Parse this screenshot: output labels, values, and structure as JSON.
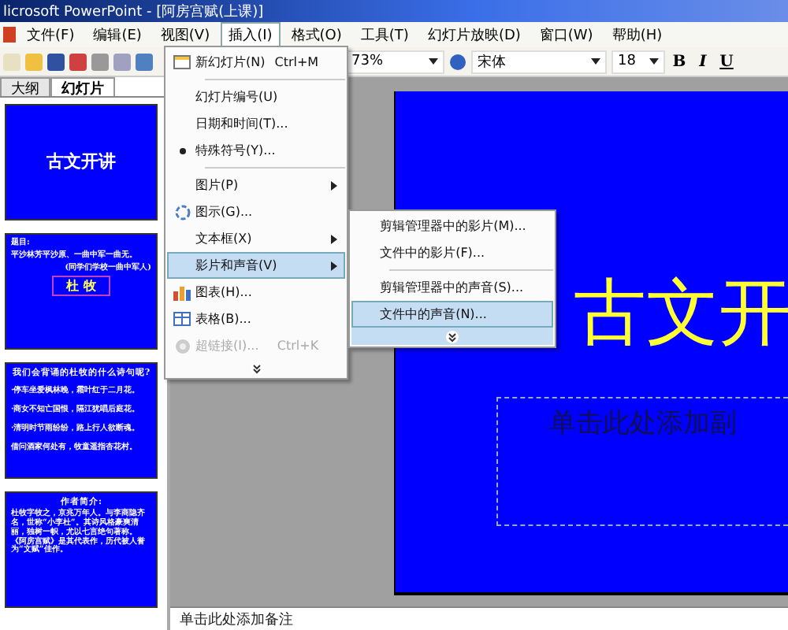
{
  "window": {
    "title": "licrosoft PowerPoint - [阿房宫赋(上课)]"
  },
  "menu_bar": [
    {
      "label": "文件(F)",
      "selected": false
    },
    {
      "label": "编辑(E)",
      "selected": false
    },
    {
      "label": "视图(V)",
      "selected": false
    },
    {
      "label": "插入(I)",
      "selected": true
    },
    {
      "label": "格式(O)",
      "selected": false
    },
    {
      "label": "工具(T)",
      "selected": false
    },
    {
      "label": "幻灯片放映(D)",
      "selected": false
    },
    {
      "label": "窗口(W)",
      "selected": false
    },
    {
      "label": "帮助(H)",
      "selected": false
    }
  ],
  "toolbar": {
    "zoom": "73%",
    "font": "宋体",
    "font_size": "18",
    "format_buttons": [
      "B",
      "I",
      "U"
    ]
  },
  "pane_tabs": [
    {
      "label": "大纲",
      "selected": false
    },
    {
      "label": "幻灯片",
      "selected": true
    }
  ],
  "thumbnails": [
    {
      "kind": "title",
      "lines": [
        "古文开讲"
      ]
    },
    {
      "kind": "intro",
      "lines": [
        "题目:",
        "平沙林芳平沙原、一曲中军一曲无。",
        "(同学们学校一曲中军人)",
        "杜  牧"
      ]
    },
    {
      "kind": "list",
      "lines": [
        "我们会背诵的杜牧的什么诗句呢?",
        "·停车坐爱枫林晚，霜叶红于二月花。",
        "·商女不知亡国恨，隔江犹唱后庭花。",
        "·清明时节雨纷纷，路上行人欲断魂。",
        "借问酒家何处有，牧童遥指杏花村。"
      ]
    },
    {
      "kind": "text",
      "lines": [
        "作者简介:",
        "杜牧字牧之，京兆万年人。与李商隐齐名，世称“小李杜”。其诗风格豪爽清丽，独树一帜，尤以七言绝句著称。《阿房宫赋》是其代表作，历代被人誉为“文赋”佳作。"
      ]
    }
  ],
  "insert_menu": [
    {
      "kind": "item",
      "label": "新幻灯片(N)",
      "shortcut": "Ctrl+M",
      "selected": false,
      "disabled": false,
      "submenu": false
    },
    {
      "kind": "separator"
    },
    {
      "kind": "item",
      "label": "幻灯片编号(U)",
      "selected": false,
      "disabled": false,
      "submenu": false
    },
    {
      "kind": "item",
      "label": "日期和时间(T)...",
      "selected": false,
      "disabled": false,
      "submenu": false
    },
    {
      "kind": "item",
      "label": "特殊符号(Y)...",
      "selected": false,
      "disabled": false,
      "submenu": false
    },
    {
      "kind": "separator"
    },
    {
      "kind": "item",
      "label": "图片(P)",
      "selected": false,
      "disabled": false,
      "submenu": true
    },
    {
      "kind": "item",
      "label": "图示(G)...",
      "selected": false,
      "disabled": false,
      "submenu": false
    },
    {
      "kind": "item",
      "label": "文本框(X)",
      "selected": false,
      "disabled": false,
      "submenu": true
    },
    {
      "kind": "item",
      "label": "影片和声音(V)",
      "selected": true,
      "disabled": false,
      "submenu": true
    },
    {
      "kind": "item",
      "label": "图表(H)...",
      "selected": false,
      "disabled": false,
      "submenu": false
    },
    {
      "kind": "item",
      "label": "表格(B)...",
      "selected": false,
      "disabled": false,
      "submenu": false
    },
    {
      "kind": "item",
      "label": "超链接(I)...",
      "shortcut": "Ctrl+K",
      "selected": false,
      "disabled": true,
      "submenu": false
    },
    {
      "kind": "expand"
    }
  ],
  "media_submenu": [
    {
      "kind": "item",
      "label": "剪辑管理器中的影片(M)...",
      "selected": false
    },
    {
      "kind": "item",
      "label": "文件中的影片(F)...",
      "selected": false
    },
    {
      "kind": "separator"
    },
    {
      "kind": "item",
      "label": "剪辑管理器中的声音(S)...",
      "selected": false
    },
    {
      "kind": "item",
      "label": "文件中的声音(N)...",
      "selected": true
    },
    {
      "kind": "expand"
    }
  ],
  "slide": {
    "title": "古文开",
    "subtitle_placeholder": "单击此处添加副"
  },
  "notes": {
    "placeholder": "单击此处添加备注"
  }
}
